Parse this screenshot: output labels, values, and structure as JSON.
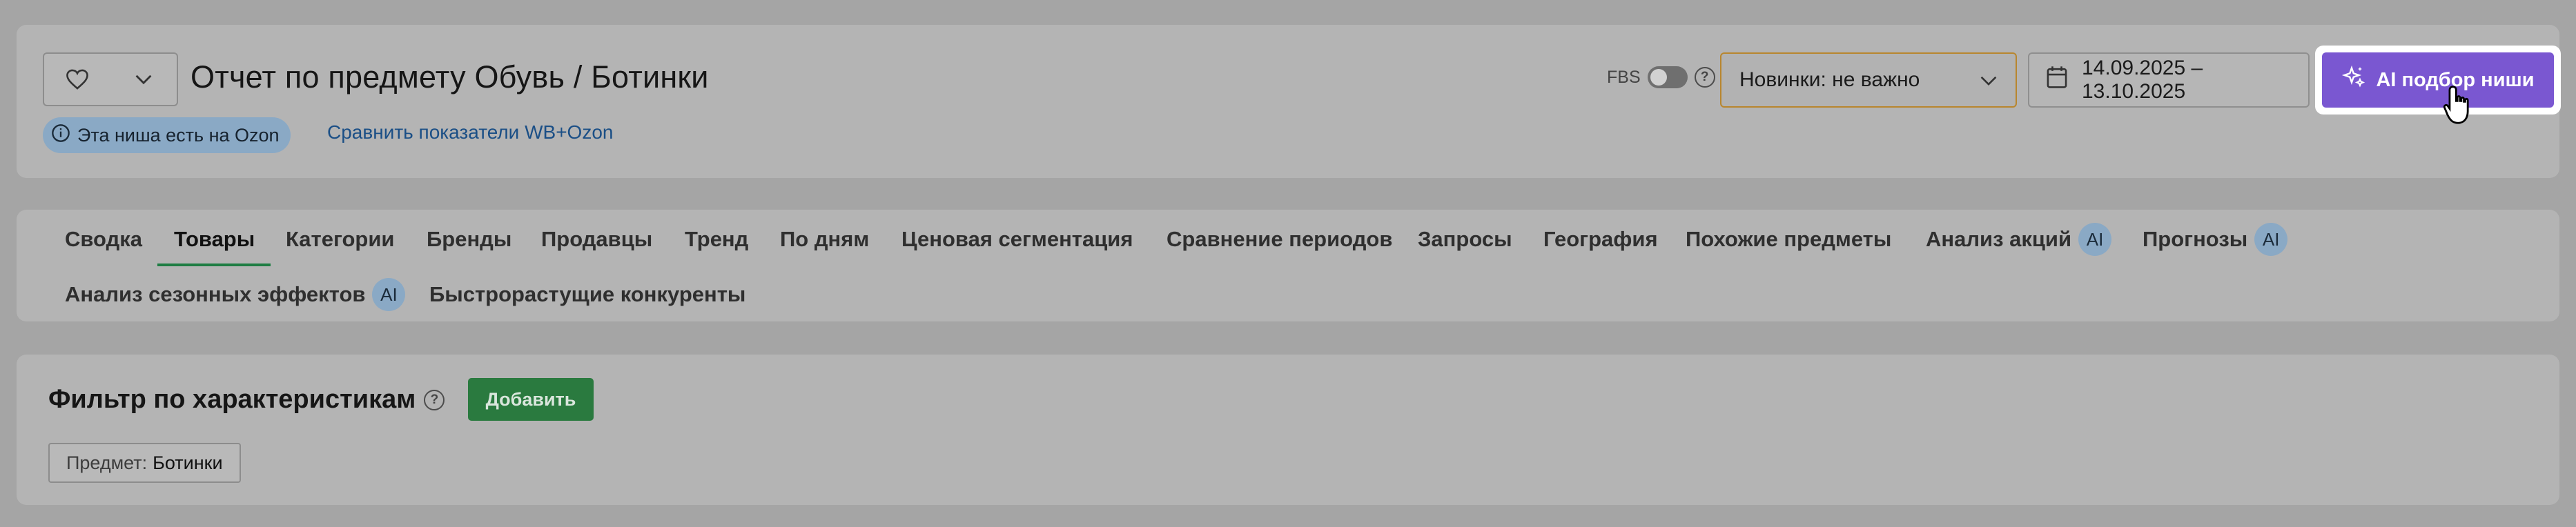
{
  "header": {
    "title": "Отчет по предмету Обувь / Ботинки",
    "ozon_badge": "Эта ниша есть на Ozon",
    "compare_link": "Сравнить показатели WB+Ozon",
    "fbs_label": "FBS",
    "help_glyph": "?",
    "novinki_select": "Новинки: не важно",
    "date_range": "14.09.2025 – 13.10.2025",
    "ai_button": "AI подбор ниши"
  },
  "tabs": [
    {
      "label": "Сводка"
    },
    {
      "label": "Товары",
      "active": true
    },
    {
      "label": "Категории"
    },
    {
      "label": "Бренды"
    },
    {
      "label": "Продавцы"
    },
    {
      "label": "Тренд"
    },
    {
      "label": "По дням"
    },
    {
      "label": "Ценовая сегментация"
    },
    {
      "label": "Сравнение периодов"
    },
    {
      "label": "Запросы"
    },
    {
      "label": "География"
    },
    {
      "label": "Похожие предметы"
    },
    {
      "label": "Анализ акций",
      "badge": "AI"
    },
    {
      "label": "Прогнозы",
      "badge": "AI"
    },
    {
      "label": "Анализ сезонных эффектов",
      "badge": "AI"
    },
    {
      "label": "Быстрорастущие конкуренты"
    }
  ],
  "filter": {
    "title": "Фильтр по характеристикам",
    "add_button": "Добавить",
    "chip_key": "Предмет:",
    "chip_value": "Ботинки"
  },
  "colors": {
    "accent_purple": "#7a57d1",
    "green": "#2a7a3f",
    "ozon_badge": "#8aa9c5",
    "select_border": "#b8862e"
  }
}
